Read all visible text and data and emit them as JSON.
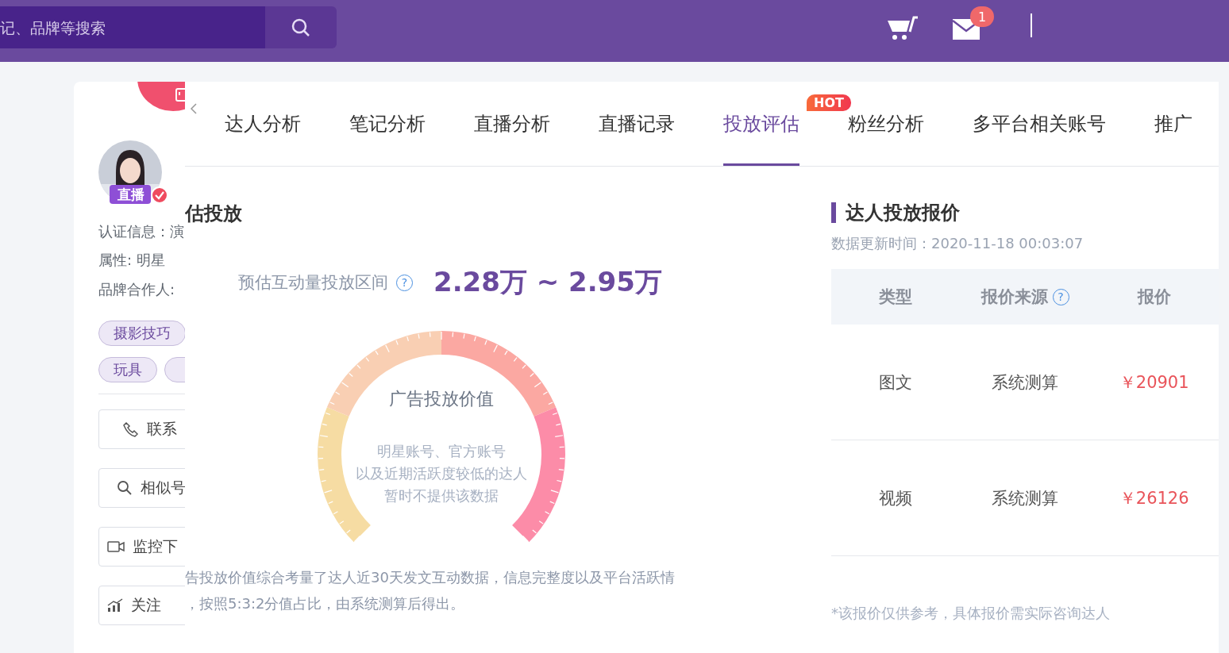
{
  "header": {
    "search": {
      "placeholder": "记、品牌等搜索"
    },
    "mail_badge": "1"
  },
  "profile": {
    "live_badge": "直播",
    "info": [
      "认证信息：演",
      "属性: 明星",
      "品牌合作人:"
    ],
    "tags": [
      "摄影技巧",
      "玩具"
    ],
    "actions": [
      {
        "label": "联系",
        "kind": "phone"
      },
      {
        "label": "相似号",
        "kind": "search"
      },
      {
        "label": "监控下",
        "kind": "video"
      },
      {
        "label": "关注",
        "kind": "chart"
      }
    ]
  },
  "tabs": [
    {
      "label": "达人分析",
      "selected": false
    },
    {
      "label": "笔记分析",
      "selected": false
    },
    {
      "label": "直播分析",
      "selected": false
    },
    {
      "label": "直播记录",
      "selected": false
    },
    {
      "label": "投放评估",
      "selected": true
    },
    {
      "label": "粉丝分析",
      "selected": false,
      "badge": "HOT"
    },
    {
      "label": "多平台相关账号",
      "selected": false
    },
    {
      "label": "推广",
      "selected": false
    }
  ],
  "estimate": {
    "title": "估投放",
    "range_label": "预估互动量投放区间",
    "help_mark": "?",
    "range_value": "2.28万 ~ 2.95万",
    "gauge": {
      "title": "广告投放价值",
      "lines": [
        "明星账号、官方账号",
        "以及近期活跃度较低的达人",
        "暂时不提供该数据"
      ]
    },
    "note": [
      "告投放价值综合考量了达人近30天发文互动数据，信息完整度以及平台活跃情",
      "，按照5:3:2分值占比，由系统测算后得出。"
    ]
  },
  "quote": {
    "title": "达人投放报价",
    "updated": "数据更新时间：2020-11-18 00:03:07",
    "columns": [
      {
        "label": "类型"
      },
      {
        "label": "报价来源",
        "help_mark": "?"
      },
      {
        "label": "报价"
      }
    ],
    "rows": [
      [
        "图文",
        "系统测算",
        "￥20901"
      ],
      [
        "视频",
        "系统测算",
        "￥26126"
      ]
    ],
    "footnote": "*该报价仅供参考，具体报价需实际咨询达人"
  }
}
